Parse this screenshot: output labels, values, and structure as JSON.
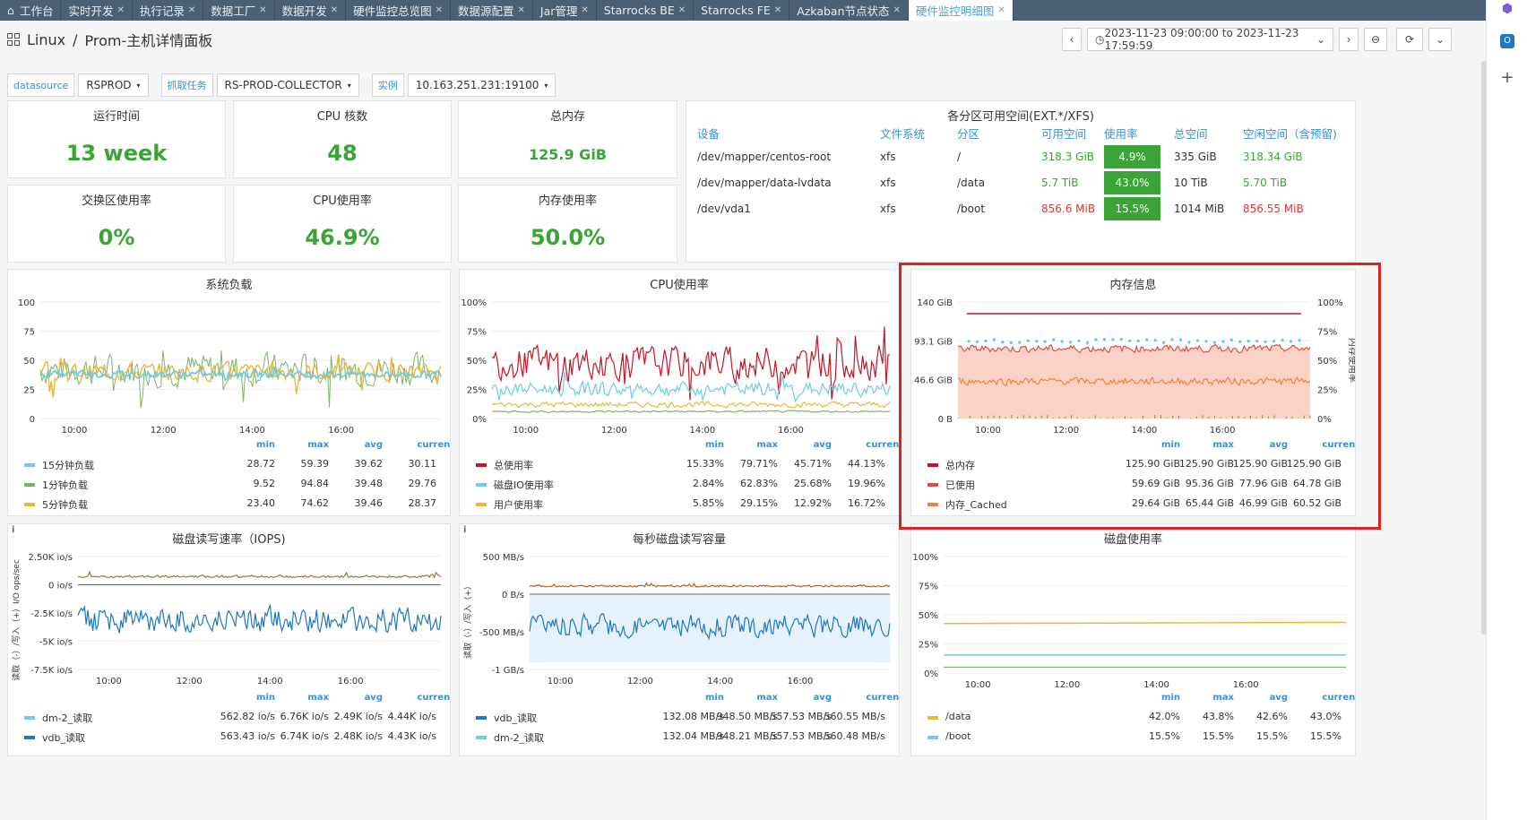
{
  "tabs": [
    {
      "label": "工作台",
      "home": true
    },
    {
      "label": "实时开发"
    },
    {
      "label": "执行记录"
    },
    {
      "label": "数据工厂"
    },
    {
      "label": "数据开发"
    },
    {
      "label": "硬件监控总览图"
    },
    {
      "label": "数据源配置"
    },
    {
      "label": "Jar管理"
    },
    {
      "label": "Starrocks BE"
    },
    {
      "label": "Starrocks FE"
    },
    {
      "label": "Azkaban节点状态"
    },
    {
      "label": "硬件监控明细图",
      "active": true
    }
  ],
  "breadcrumb": {
    "folder": "Linux",
    "sep": "/",
    "title": "Prom-主机详情面板"
  },
  "time_range": "2023-11-23 09:00:00 to 2023-11-23 17:59:59",
  "variables": [
    {
      "label": "datasource",
      "value": "RSPROD"
    },
    {
      "label": "抓取任务",
      "value": "RS-PROD-COLLECTOR"
    },
    {
      "label": "实例",
      "value": "10.163.251.231:19100"
    }
  ],
  "stats": [
    {
      "title": "运行时间",
      "value": "13 week"
    },
    {
      "title": "CPU 核数",
      "value": "48"
    },
    {
      "title": "总内存",
      "value": "125.9 GiB"
    },
    {
      "title": "交换区使用率",
      "value": "0%"
    },
    {
      "title": "CPU使用率",
      "value": "46.9%"
    },
    {
      "title": "内存使用率",
      "value": "50.0%"
    }
  ],
  "partition": {
    "title": "各分区可用空间(EXT.*/XFS)",
    "headers": [
      "设备",
      "文件系统",
      "分区",
      "可用空间",
      "使用率",
      "总空间",
      "空闲空间（含预留)"
    ],
    "rows": [
      {
        "device": "/dev/mapper/centos-root",
        "fs": "xfs",
        "mount": "/",
        "avail": "318.3 GiB",
        "usage": "4.9%",
        "total": "335 GiB",
        "free": "318.34 GiB",
        "low": false
      },
      {
        "device": "/dev/mapper/data-lvdata",
        "fs": "xfs",
        "mount": "/data",
        "avail": "5.7 TiB",
        "usage": "43.0%",
        "total": "10 TiB",
        "free": "5.70 TiB",
        "low": false
      },
      {
        "device": "/dev/vda1",
        "fs": "xfs",
        "mount": "/boot",
        "avail": "856.6 MiB",
        "usage": "15.5%",
        "total": "1014 MiB",
        "free": "856.55 MiB",
        "low": true
      }
    ]
  },
  "legend_headers": [
    "min",
    "max",
    "avg",
    "current"
  ],
  "charts": {
    "load": {
      "title": "系统负载",
      "yticks": [
        "100",
        "75",
        "50",
        "25",
        "0"
      ],
      "xticks": [
        "10:00",
        "12:00",
        "14:00",
        "16:00"
      ],
      "legend": [
        {
          "name": "15分钟负载",
          "color": "#6ecde0",
          "min": "28.72",
          "max": "59.39",
          "avg": "39.62",
          "current": "30.11"
        },
        {
          "name": "1分钟负载",
          "color": "#7eb26d",
          "min": "9.52",
          "max": "94.84",
          "avg": "39.48",
          "current": "29.76"
        },
        {
          "name": "5分钟负载",
          "color": "#eab839",
          "min": "23.40",
          "max": "74.62",
          "avg": "39.46",
          "current": "28.37"
        }
      ]
    },
    "cpu": {
      "title": "CPU使用率",
      "yticks": [
        "100%",
        "75%",
        "50%",
        "25%",
        "0%"
      ],
      "xticks": [
        "10:00",
        "12:00",
        "14:00",
        "16:00"
      ],
      "legend": [
        {
          "name": "总使用率",
          "color": "#c4162a",
          "min": "15.33%",
          "max": "79.71%",
          "avg": "45.71%",
          "current": "44.13%"
        },
        {
          "name": "磁盘IO使用率",
          "color": "#6ecde0",
          "min": "2.84%",
          "max": "62.83%",
          "avg": "25.68%",
          "current": "19.96%"
        },
        {
          "name": "用户使用率",
          "color": "#eab839",
          "min": "5.85%",
          "max": "29.15%",
          "avg": "12.92%",
          "current": "16.72%"
        }
      ]
    },
    "mem": {
      "title": "内存信息",
      "yticks": [
        "140 GiB",
        "93.1 GiB",
        "46.6 GiB",
        "0 B"
      ],
      "y2ticks": [
        "100%",
        "75%",
        "50%",
        "25%",
        "0%"
      ],
      "y2label": "内存使用率",
      "xticks": [
        "10:00",
        "12:00",
        "14:00",
        "16:00"
      ],
      "legend": [
        {
          "name": "总内存",
          "color": "#c4162a",
          "min": "125.90 GiB",
          "max": "125.90 GiB",
          "avg": "125.90 GiB",
          "current": "125.90 GiB"
        },
        {
          "name": "已使用",
          "color": "#e24d42",
          "min": "59.69 GiB",
          "max": "95.36 GiB",
          "avg": "77.96 GiB",
          "current": "64.78 GiB"
        },
        {
          "name": "内存_Cached",
          "color": "#ef843c",
          "min": "29.64 GiB",
          "max": "65.44 GiB",
          "avg": "46.99 GiB",
          "current": "60.52 GiB"
        }
      ]
    },
    "iops": {
      "title": "磁盘读写速率（IOPS)",
      "yticks": [
        "2.50K io/s",
        "0 io/s",
        "-2.5K io/s",
        "-5K io/s",
        "-7.5K io/s"
      ],
      "ylabel": "读取（-）/写入（+）I/O ops/sec",
      "xticks": [
        "10:00",
        "12:00",
        "14:00",
        "16:00"
      ],
      "legend": [
        {
          "name": "dm-2_读取",
          "color": "#6ecde0",
          "min": "562.82 io/s",
          "max": "6.76K io/s",
          "avg": "2.49K io/s",
          "current": "4.44K io/s"
        },
        {
          "name": "vdb_读取",
          "color": "#1f78c1",
          "min": "563.43 io/s",
          "max": "6.74K io/s",
          "avg": "2.48K io/s",
          "current": "4.43K io/s"
        }
      ]
    },
    "disk": {
      "title": "每秒磁盘读写容量",
      "yticks": [
        "500 MB/s",
        "0 B/s",
        "-500 MB/s",
        "-1 GB/s"
      ],
      "ylabel": "读取（-）/写入（+）",
      "xticks": [
        "10:00",
        "12:00",
        "14:00",
        "16:00"
      ],
      "legend": [
        {
          "name": "vdb_读取",
          "color": "#1f78c1",
          "min": "132.08 MB/s",
          "max": "948.50 MB/s",
          "avg": "557.53 MB/s",
          "current": "560.55 MB/s"
        },
        {
          "name": "dm-2_读取",
          "color": "#6ecde0",
          "min": "132.04 MB/s",
          "max": "948.21 MB/s",
          "avg": "557.53 MB/s",
          "current": "560.48 MB/s"
        }
      ]
    },
    "du": {
      "title": "磁盘使用率",
      "yticks": [
        "100%",
        "75%",
        "50%",
        "25%",
        "0%"
      ],
      "xticks": [
        "10:00",
        "12:00",
        "14:00",
        "16:00"
      ],
      "legend": [
        {
          "name": "/data",
          "color": "#eab839",
          "min": "42.0%",
          "max": "43.8%",
          "avg": "42.6%",
          "current": "43.0%"
        },
        {
          "name": "/boot",
          "color": "#6ecde0",
          "min": "15.5%",
          "max": "15.5%",
          "avg": "15.5%",
          "current": "15.5%"
        }
      ]
    }
  },
  "chart_data": [
    {
      "type": "line",
      "title": "系统负载",
      "ylim": [
        0,
        100
      ],
      "x": [
        "09:00",
        "10:00",
        "11:00",
        "12:00",
        "13:00",
        "14:00",
        "15:00",
        "16:00",
        "17:00",
        "18:00"
      ],
      "series": [
        {
          "name": "15分钟负载",
          "values": [
            40,
            42,
            41,
            38,
            40,
            39,
            38,
            41,
            39,
            30
          ]
        },
        {
          "name": "1分钟负载",
          "values": [
            45,
            36,
            52,
            40,
            35,
            48,
            30,
            55,
            42,
            29
          ]
        },
        {
          "name": "5分钟负载",
          "values": [
            42,
            38,
            46,
            39,
            37,
            44,
            33,
            50,
            40,
            28
          ]
        }
      ]
    },
    {
      "type": "line",
      "title": "CPU使用率",
      "ylim": [
        0,
        100
      ],
      "x": [
        "09:00",
        "10:00",
        "11:00",
        "12:00",
        "13:00",
        "14:00",
        "15:00",
        "16:00",
        "17:00",
        "18:00"
      ],
      "series": [
        {
          "name": "总使用率",
          "values": [
            45,
            48,
            52,
            40,
            42,
            47,
            50,
            44,
            46,
            44
          ]
        },
        {
          "name": "磁盘IO使用率",
          "values": [
            25,
            28,
            30,
            22,
            24,
            26,
            28,
            24,
            25,
            20
          ]
        },
        {
          "name": "用户使用率",
          "values": [
            12,
            13,
            14,
            11,
            12,
            13,
            14,
            12,
            13,
            17
          ]
        }
      ]
    },
    {
      "type": "line",
      "title": "内存信息",
      "x": [
        "09:00",
        "10:00",
        "11:00",
        "12:00",
        "13:00",
        "14:00",
        "15:00",
        "16:00",
        "17:00",
        "18:00"
      ],
      "series": [
        {
          "name": "总内存",
          "values": [
            125.9,
            125.9,
            125.9,
            125.9,
            125.9,
            125.9,
            125.9,
            125.9,
            125.9,
            125.9
          ]
        },
        {
          "name": "已使用",
          "values": [
            85,
            88,
            86,
            87,
            84,
            89,
            87,
            86,
            88,
            65
          ]
        },
        {
          "name": "内存_Cached",
          "values": [
            45,
            44,
            46,
            47,
            60,
            45,
            44,
            46,
            47,
            60
          ]
        }
      ]
    },
    {
      "type": "line",
      "title": "磁盘读写速率（IOPS)",
      "x": [
        "09:00",
        "10:00",
        "11:00",
        "12:00",
        "13:00",
        "14:00",
        "15:00",
        "16:00",
        "17:00",
        "18:00"
      ],
      "series": [
        {
          "name": "dm-2_读取",
          "values": [
            -2500,
            -2400,
            -2600,
            -2300,
            -2500,
            -2700,
            -2400,
            -2500,
            -2600,
            -4440
          ]
        },
        {
          "name": "vdb_读取",
          "values": [
            -2480,
            -2390,
            -2590,
            -2290,
            -2490,
            -2690,
            -2390,
            -2490,
            -2590,
            -4430
          ]
        }
      ]
    },
    {
      "type": "line",
      "title": "每秒磁盘读写容量",
      "x": [
        "09:00",
        "10:00",
        "11:00",
        "12:00",
        "13:00",
        "14:00",
        "15:00",
        "16:00",
        "17:00",
        "18:00"
      ],
      "series": [
        {
          "name": "vdb_读取",
          "values": [
            -560,
            -540,
            -580,
            -550,
            -560,
            -570,
            -550,
            -560,
            -570,
            -560
          ]
        },
        {
          "name": "dm-2_读取",
          "values": [
            -560,
            -540,
            -580,
            -550,
            -560,
            -570,
            -550,
            -560,
            -570,
            -560
          ]
        }
      ]
    },
    {
      "type": "line",
      "title": "磁盘使用率",
      "ylim": [
        0,
        100
      ],
      "x": [
        "09:00",
        "10:00",
        "11:00",
        "12:00",
        "13:00",
        "14:00",
        "15:00",
        "16:00",
        "17:00",
        "18:00"
      ],
      "series": [
        {
          "name": "/data",
          "values": [
            42.0,
            42.2,
            42.3,
            42.4,
            42.5,
            42.6,
            42.8,
            43.0,
            43.2,
            43.0
          ]
        },
        {
          "name": "/boot",
          "values": [
            15.5,
            15.5,
            15.5,
            15.5,
            15.5,
            15.5,
            15.5,
            15.5,
            15.5,
            15.5
          ]
        }
      ]
    }
  ]
}
